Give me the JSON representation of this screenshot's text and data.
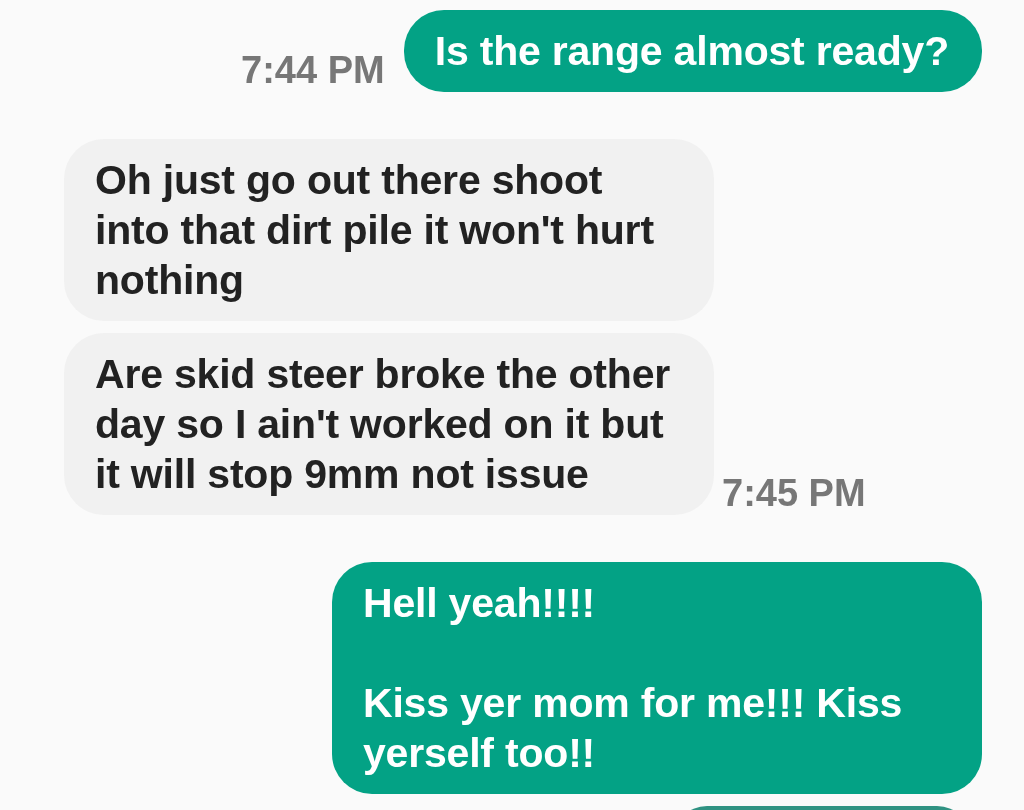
{
  "messages": [
    {
      "kind": "sent",
      "text": "Is the range almost ready?",
      "time": "7:44 PM"
    },
    {
      "kind": "received",
      "text": "Oh just go out there shoot into that dirt pile it won't hurt nothing"
    },
    {
      "kind": "received",
      "text": "Are skid steer broke the other day so I ain't worked on it but it will stop 9mm not issue",
      "time": "7:45 PM"
    },
    {
      "kind": "sent",
      "text": "Hell yeah!!!!\n\nKiss yer mom for me!!! Kiss yerself too!!"
    },
    {
      "kind": "sent"
    }
  ]
}
